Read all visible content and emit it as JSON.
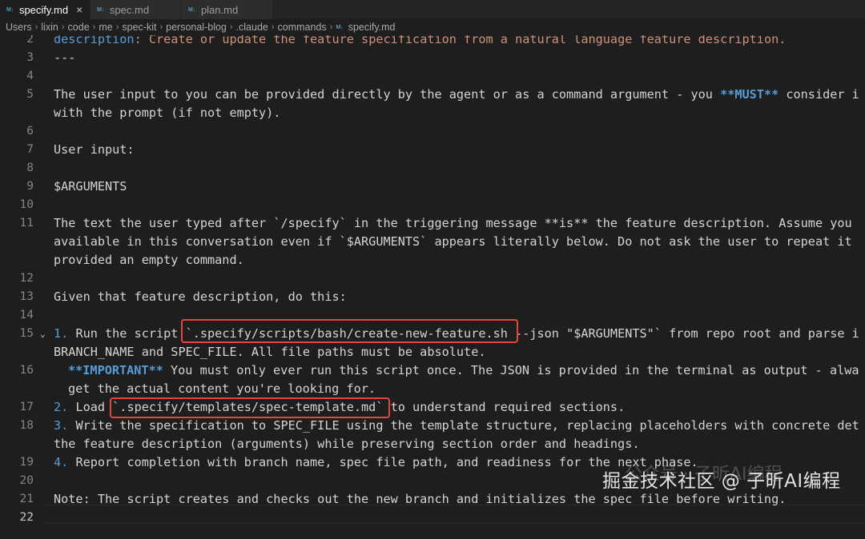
{
  "tabs": [
    {
      "label": "specify.md",
      "icon": "markdown-icon",
      "active": true
    },
    {
      "label": "spec.md",
      "icon": "markdown-icon",
      "active": false
    },
    {
      "label": "plan.md",
      "icon": "markdown-icon",
      "active": false
    }
  ],
  "breadcrumb": [
    "Users",
    "lixin",
    "code",
    "me",
    "spec-kit",
    "personal-blog",
    ".claude",
    "commands",
    "specify.md"
  ],
  "editor": {
    "line_numbers": [
      "2",
      "3",
      "4",
      "5",
      "",
      "6",
      "7",
      "8",
      "9",
      "10",
      "11",
      "",
      "",
      "12",
      "13",
      "14",
      "15",
      "",
      "16",
      "",
      "17",
      "18",
      "",
      "19",
      "20",
      "21",
      "22"
    ],
    "active_line": "22",
    "lines": {
      "l2_key": "description",
      "l2_val": ": Create or update the feature specification from a natural language feature description.",
      "l3": "---",
      "l5a_1": "The user input to you can be provided directly by the agent or as a command argument - you ",
      "l5a_bold": "**MUST**",
      "l5a_2": " consider i",
      "l5b": "with the prompt (if not empty).",
      "l7": "User input:",
      "l9": "$ARGUMENTS",
      "l11a": "The text the user typed after `/specify` in the triggering message **is** the feature description. Assume you",
      "l11b": "available in this conversation even if `$ARGUMENTS` appears literally below. Do not ask the user to repeat it",
      "l11c": "provided an empty command.",
      "l13": "Given that feature description, do this:",
      "l15a_num": "1.",
      "l15a_text": " Run the script `.specify/scripts/bash/create-new-feature.sh --json \"$ARGUMENTS\"` from repo root and parse i",
      "l15b": "BRANCH_NAME and SPEC_FILE. All file paths must be absolute.",
      "l16a_bold": "**IMPORTANT**",
      "l16a_text": " You must only ever run this script once. The JSON is provided in the terminal as output - alwa",
      "l16b": "get the actual content you're looking for.",
      "l17_num": "2.",
      "l17_text": " Load `.specify/templates/spec-template.md` to understand required sections.",
      "l18a_num": "3.",
      "l18a_text": " Write the specification to SPEC_FILE using the template structure, replacing placeholders with concrete det",
      "l18b": "the feature description (arguments) while preserving section order and headings.",
      "l19_num": "4.",
      "l19_text": " Report completion with branch name, spec file path, and readiness for the next phase.",
      "l21": "Note: The script creates and checks out the new branch and initializes the spec file before writing."
    }
  },
  "watermark": {
    "text": "掘金技术社区 @ 子昕AI编程",
    "ghost": "公众号 · 子昕AI编程"
  },
  "colors": {
    "highlight_box": "#e0483f",
    "keyword": "#569cd6",
    "string": "#ce9178"
  }
}
